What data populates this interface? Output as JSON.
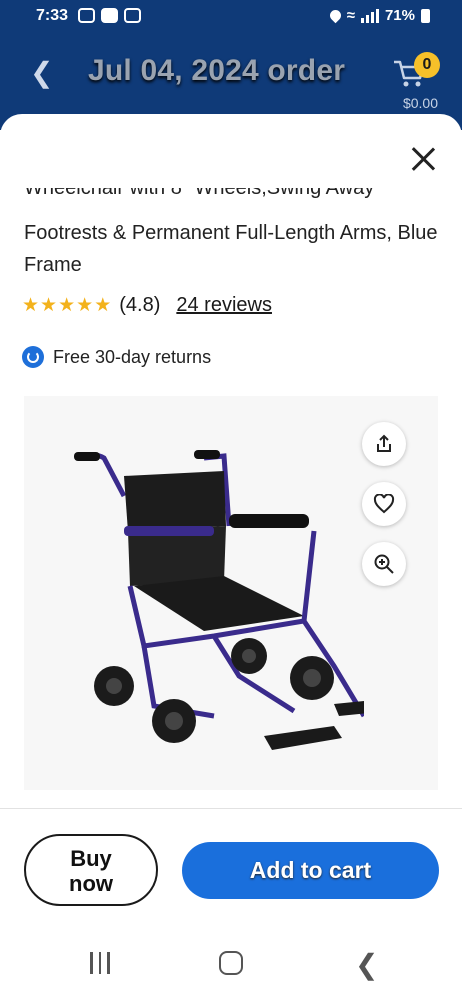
{
  "status_bar": {
    "time": "7:33",
    "battery": "71%"
  },
  "header": {
    "title": "Jul 04, 2024 order",
    "cart_count": "0",
    "cart_total": "$0.00"
  },
  "product": {
    "title_cut": "Wheelchair with 8\" Wheels,Swing Away",
    "title": "Footrests & Permanent Full-Length Arms, Blue Frame",
    "rating": "(4.8)",
    "reviews": "24 reviews",
    "returns": "Free 30-day returns",
    "stars": 4.8
  },
  "actions": {
    "buy_now": "Buy now",
    "add_to_cart": "Add to cart"
  },
  "colors": {
    "header_bg": "#0f3a78",
    "primary": "#1a6fdc",
    "star": "#f3b21c",
    "badge": "#f6c02a"
  },
  "icons": {
    "share": "share-icon",
    "favorite": "heart-icon",
    "zoom": "zoom-icon",
    "close": "close-icon"
  }
}
